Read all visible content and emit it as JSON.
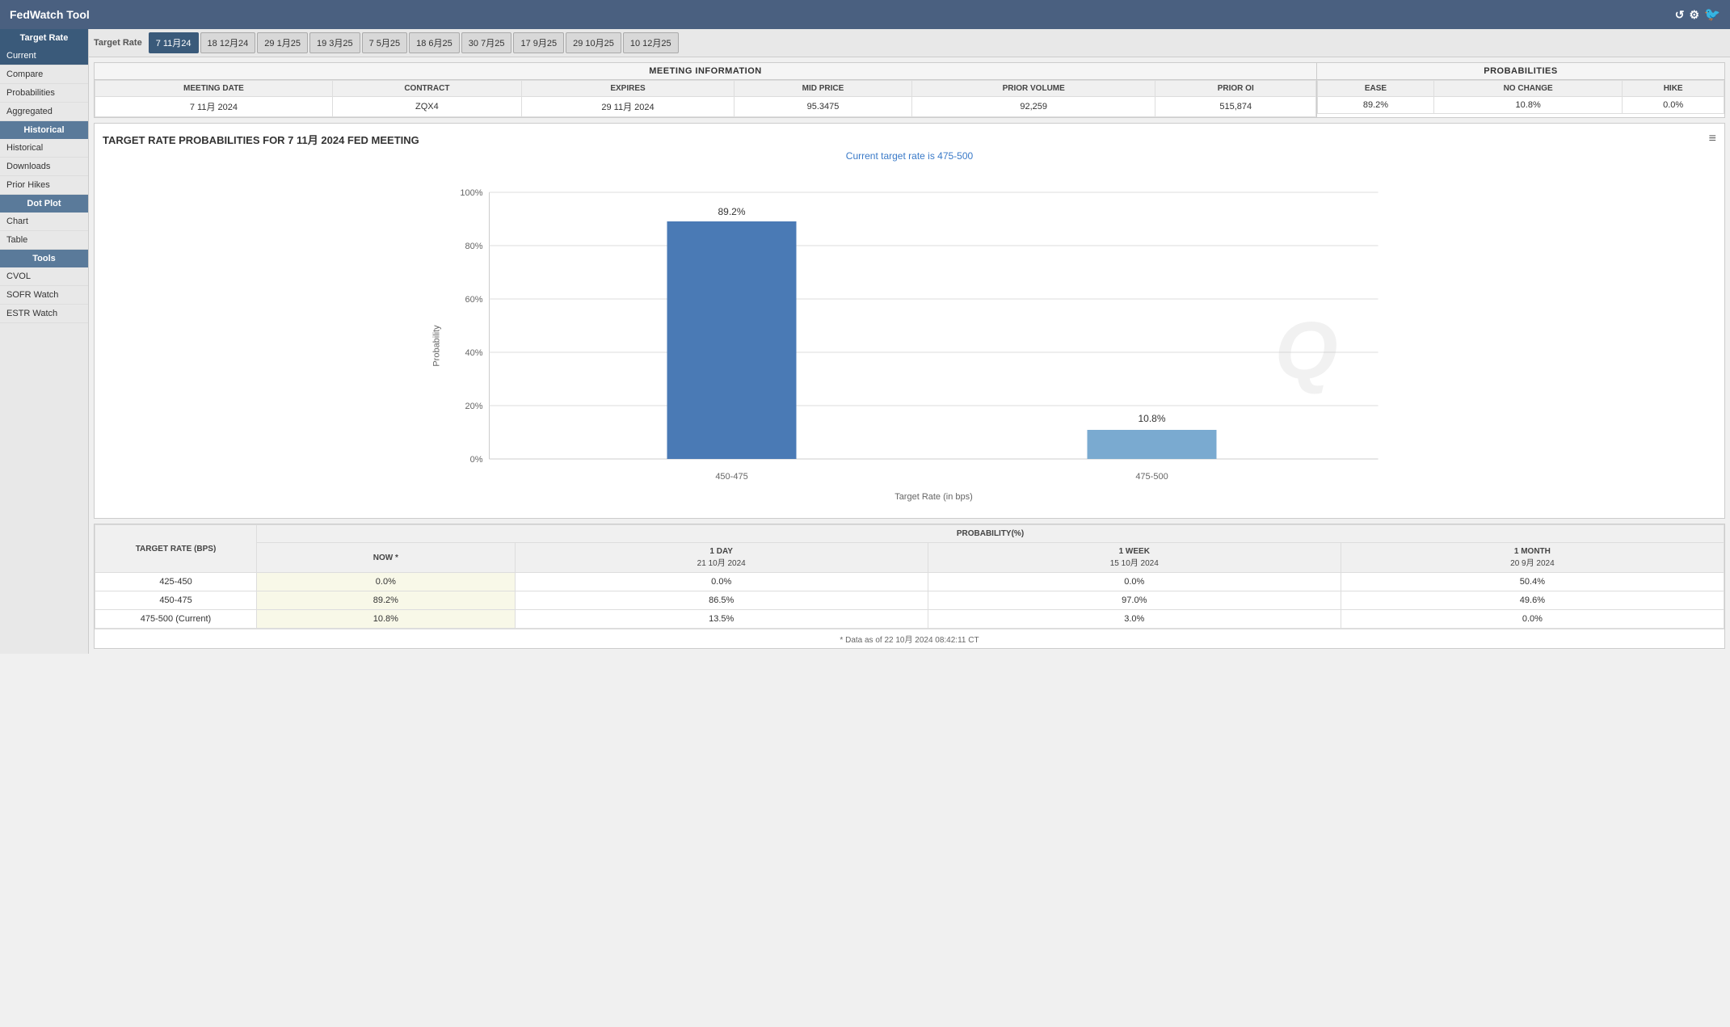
{
  "titleBar": {
    "title": "FedWatch Tool",
    "refreshIcon": "↺",
    "settingsIcon": "⚙"
  },
  "tabs": {
    "label": "Target Rate",
    "items": [
      {
        "label": "7 11月24",
        "active": true
      },
      {
        "label": "18 12月24",
        "active": false
      },
      {
        "label": "29 1月25",
        "active": false
      },
      {
        "label": "19 3月25",
        "active": false
      },
      {
        "label": "7 5月25",
        "active": false
      },
      {
        "label": "18 6月25",
        "active": false
      },
      {
        "label": "30 7月25",
        "active": false
      },
      {
        "label": "17 9月25",
        "active": false
      },
      {
        "label": "29 10月25",
        "active": false
      },
      {
        "label": "10 12月25",
        "active": false
      }
    ]
  },
  "sidebar": {
    "targetRateHeader": "Target Rate",
    "items": [
      {
        "label": "Current",
        "active": true,
        "group": "target"
      },
      {
        "label": "Compare",
        "active": false,
        "group": "target"
      },
      {
        "label": "Probabilities",
        "active": false,
        "group": "target"
      },
      {
        "label": "Aggregated",
        "active": false,
        "group": "target"
      }
    ],
    "historicalHeader": "Historical",
    "historicalItems": [
      {
        "label": "Historical",
        "active": false
      },
      {
        "label": "Downloads",
        "active": false
      },
      {
        "label": "Prior Hikes",
        "active": false
      }
    ],
    "dotPlotHeader": "Dot Plot",
    "dotPlotItems": [
      {
        "label": "Chart",
        "active": false
      },
      {
        "label": "Table",
        "active": false
      }
    ],
    "toolsHeader": "Tools",
    "toolsItems": [
      {
        "label": "CVOL",
        "active": false
      },
      {
        "label": "SOFR Watch",
        "active": false
      },
      {
        "label": "ESTR Watch",
        "active": false
      }
    ]
  },
  "meetingInfo": {
    "sectionTitle": "MEETING INFORMATION",
    "columns": [
      "MEETING DATE",
      "CONTRACT",
      "EXPIRES",
      "MID PRICE",
      "PRIOR VOLUME",
      "PRIOR OI"
    ],
    "row": {
      "meetingDate": "7 11月 2024",
      "contract": "ZQX4",
      "expires": "29 11月 2024",
      "midPrice": "95.3475",
      "priorVolume": "92,259",
      "priorOI": "515,874"
    }
  },
  "probabilities": {
    "sectionTitle": "PROBABILITIES",
    "columns": [
      "EASE",
      "NO CHANGE",
      "HIKE"
    ],
    "row": {
      "ease": "89.2%",
      "noChange": "10.8%",
      "hike": "0.0%"
    }
  },
  "chart": {
    "title": "TARGET RATE PROBABILITIES FOR 7 11月 2024 FED MEETING",
    "subtitle": "Current target rate is 475-500",
    "menuIcon": "≡",
    "yAxisLabel": "Probability",
    "xAxisLabel": "Target Rate (in bps)",
    "yAxisTicks": [
      "0%",
      "20%",
      "40%",
      "60%",
      "80%",
      "100%"
    ],
    "bars": [
      {
        "label": "450-475",
        "value": 89.2,
        "color": "#4a7ab5"
      },
      {
        "label": "475-500",
        "value": 10.8,
        "color": "#7aaad0"
      }
    ]
  },
  "probTable": {
    "sectionTitle": "PROBABILITY(%)",
    "targetRateLabel": "TARGET RATE (BPS)",
    "columns": [
      {
        "label": "NOW *",
        "sub": ""
      },
      {
        "label": "1 DAY",
        "sub": "21 10月 2024"
      },
      {
        "label": "1 WEEK",
        "sub": "15 10月 2024"
      },
      {
        "label": "1 MONTH",
        "sub": "20 9月 2024"
      }
    ],
    "rows": [
      {
        "rate": "425-450",
        "now": "0.0%",
        "oneDay": "0.0%",
        "oneWeek": "0.0%",
        "oneMonth": "50.4%"
      },
      {
        "rate": "450-475",
        "now": "89.2%",
        "oneDay": "86.5%",
        "oneWeek": "97.0%",
        "oneMonth": "49.6%"
      },
      {
        "rate": "475-500 (Current)",
        "now": "10.8%",
        "oneDay": "13.5%",
        "oneWeek": "3.0%",
        "oneMonth": "0.0%"
      }
    ],
    "footnote": "* Data as of 22 10月 2024 08:42:11 CT"
  }
}
